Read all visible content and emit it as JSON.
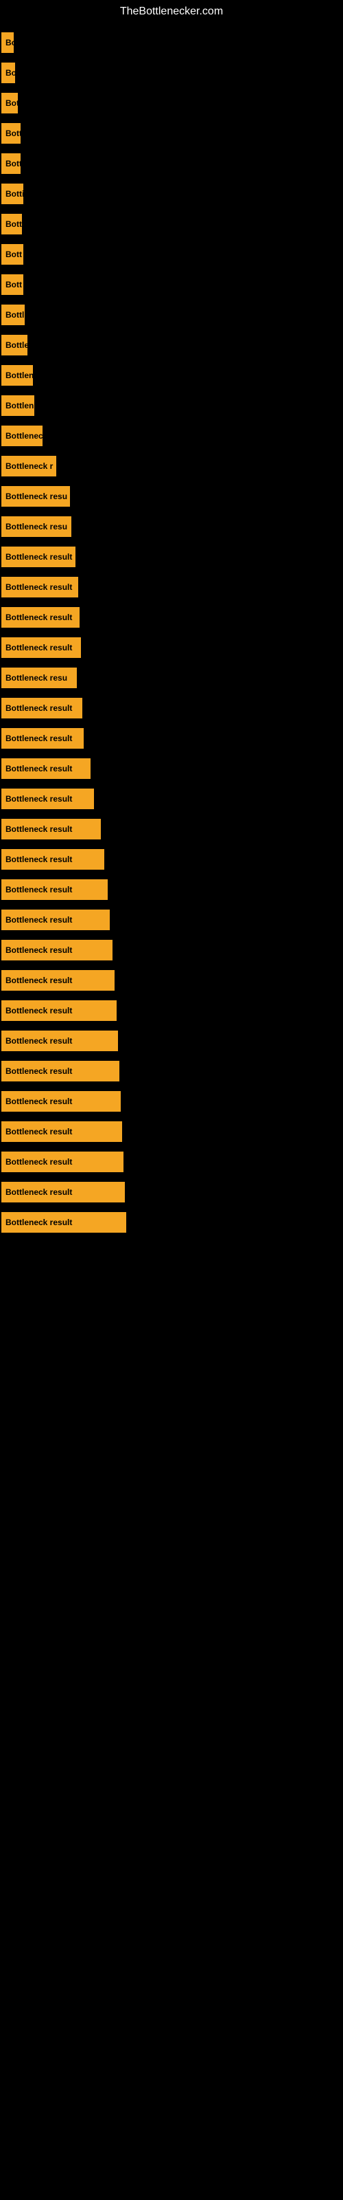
{
  "site": {
    "title": "TheBottlenecker.com"
  },
  "bars": [
    {
      "label": "Bo",
      "width": 18
    },
    {
      "label": "Bo",
      "width": 20
    },
    {
      "label": "Bot",
      "width": 24
    },
    {
      "label": "Bott",
      "width": 28
    },
    {
      "label": "Bott",
      "width": 28
    },
    {
      "label": "Botti",
      "width": 32
    },
    {
      "label": "Bott",
      "width": 30
    },
    {
      "label": "Bott",
      "width": 32
    },
    {
      "label": "Bott",
      "width": 32
    },
    {
      "label": "Bottl",
      "width": 34
    },
    {
      "label": "Bottle",
      "width": 38
    },
    {
      "label": "Bottlen",
      "width": 46
    },
    {
      "label": "Bottlen",
      "width": 48
    },
    {
      "label": "Bottlenec",
      "width": 60
    },
    {
      "label": "Bottleneck r",
      "width": 80
    },
    {
      "label": "Bottleneck resu",
      "width": 100
    },
    {
      "label": "Bottleneck resu",
      "width": 102
    },
    {
      "label": "Bottleneck result",
      "width": 108
    },
    {
      "label": "Bottleneck result",
      "width": 112
    },
    {
      "label": "Bottleneck result",
      "width": 114
    },
    {
      "label": "Bottleneck result",
      "width": 116
    },
    {
      "label": "Bottleneck resu",
      "width": 110
    },
    {
      "label": "Bottleneck result",
      "width": 118
    },
    {
      "label": "Bottleneck result",
      "width": 120
    },
    {
      "label": "Bottleneck result",
      "width": 130
    },
    {
      "label": "Bottleneck result",
      "width": 135
    },
    {
      "label": "Bottleneck result",
      "width": 145
    },
    {
      "label": "Bottleneck result",
      "width": 150
    },
    {
      "label": "Bottleneck result",
      "width": 155
    },
    {
      "label": "Bottleneck result",
      "width": 158
    },
    {
      "label": "Bottleneck result",
      "width": 162
    },
    {
      "label": "Bottleneck result",
      "width": 165
    },
    {
      "label": "Bottleneck result",
      "width": 168
    },
    {
      "label": "Bottleneck result",
      "width": 170
    },
    {
      "label": "Bottleneck result",
      "width": 172
    },
    {
      "label": "Bottleneck result",
      "width": 174
    },
    {
      "label": "Bottleneck result",
      "width": 176
    },
    {
      "label": "Bottleneck result",
      "width": 178
    },
    {
      "label": "Bottleneck result",
      "width": 180
    },
    {
      "label": "Bottleneck result",
      "width": 182
    }
  ],
  "colors": {
    "bar": "#f5a623",
    "background": "#000000",
    "text": "#ffffff"
  }
}
